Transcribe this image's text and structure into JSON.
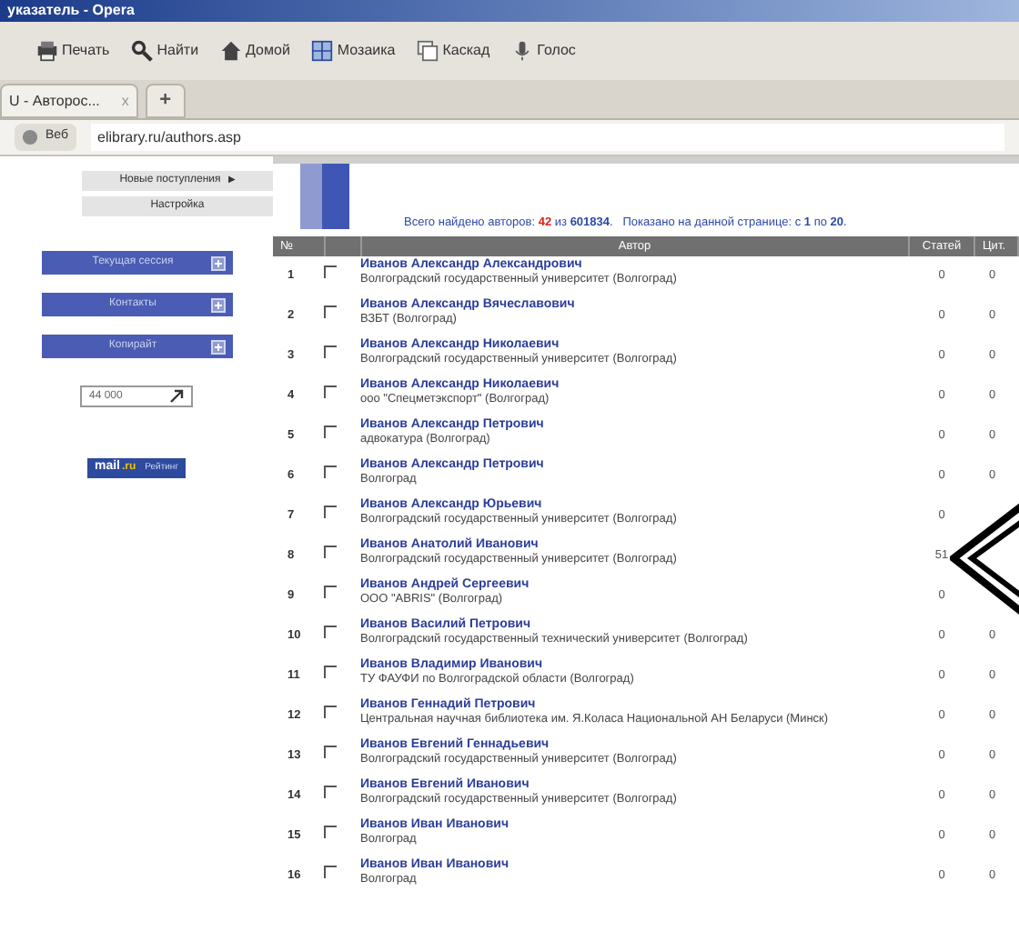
{
  "window": {
    "title": "указатель - Opera"
  },
  "toolbar": [
    "Печать",
    "Найти",
    "Домой",
    "Мозаика",
    "Каскад",
    "Голос"
  ],
  "tab": {
    "label": "U - Авторос...",
    "close": "x",
    "new_tab": "+"
  },
  "address": {
    "badge": "Веб",
    "url": "elibrary.ru/authors.asp"
  },
  "sidebar": {
    "links": [
      {
        "label": "Новые поступления",
        "arrow": "▶"
      },
      {
        "label": "Настройка"
      }
    ],
    "sections": [
      "Текущая сессия",
      "Контакты",
      "Копирайт"
    ],
    "counter": "44 000",
    "rating": {
      "mail": "mail",
      "ru": ".ru",
      "text": "Рейтинг"
    }
  },
  "summary": {
    "prefix": "Всего найдено авторов: ",
    "found": "42",
    "mid": " из ",
    "total": "601834",
    "shown": ".   Показано на данной странице: с ",
    "from": "1",
    "to_word": " по ",
    "to": "20",
    "end": "."
  },
  "table": {
    "columns": [
      "№",
      "Автор",
      "Статей",
      "Цит."
    ],
    "rows": [
      {
        "n": "1",
        "name": "Иванов Александр Александрович",
        "org": "Волгоградский государственный университет (Волгоград)",
        "papers": "0",
        "cites": "0",
        "checked": false
      },
      {
        "n": "2",
        "name": "Иванов Александр Вячеславович",
        "org": "ВЗБТ (Волгоград)",
        "papers": "0",
        "cites": "0",
        "checked": false
      },
      {
        "n": "3",
        "name": "Иванов Александр Николаевич",
        "org": "Волгоградский государственный университет (Волгоград)",
        "papers": "0",
        "cites": "0",
        "checked": false
      },
      {
        "n": "4",
        "name": "Иванов Александр Николаевич",
        "org": "ооо \"Спецметэкспорт\" (Волгоград)",
        "papers": "0",
        "cites": "0",
        "checked": false
      },
      {
        "n": "5",
        "name": "Иванов Александр Петрович",
        "org": "адвокатура (Волгоград)",
        "papers": "0",
        "cites": "0",
        "checked": false
      },
      {
        "n": "6",
        "name": "Иванов Александр Петрович",
        "org": "Волгоград",
        "papers": "0",
        "cites": "0",
        "checked": false
      },
      {
        "n": "7",
        "name": "Иванов Александр Юрьевич",
        "org": "Волгоградский государственный университет (Волгоград)",
        "papers": "0",
        "checked": false
      },
      {
        "n": "8",
        "name": "Иванов Анатолий Иванович",
        "org": "Волгоградский государственный университет (Волгоград)",
        "papers": "51",
        "checked": false
      },
      {
        "n": "9",
        "name": "Иванов Андрей Сергеевич",
        "org": "ООО \"ABRIS\" (Волгоград)",
        "papers": "0",
        "checked": false
      },
      {
        "n": "10",
        "name": "Иванов Василий Петрович",
        "org": "Волгоградский государственный технический университет (Волгоград)",
        "papers": "0",
        "cites": "0",
        "checked": false
      },
      {
        "n": "11",
        "name": "Иванов Владимир Иванович",
        "org": "ТУ ФАУФИ по Волгоградской области (Волгоград)",
        "papers": "0",
        "cites": "0",
        "checked": false
      },
      {
        "n": "12",
        "name": "Иванов Геннадий Петрович",
        "org": "Центральная научная библиотека им. Я.Коласа Национальной АН Беларуси (Минск)",
        "papers": "0",
        "cites": "0",
        "checked": false
      },
      {
        "n": "13",
        "name": "Иванов Евгений Геннадьевич",
        "org": "Волгоградский государственный университет (Волгоград)",
        "papers": "0",
        "cites": "0",
        "checked": false
      },
      {
        "n": "14",
        "name": "Иванов Евгений Иванович",
        "org": "Волгоградский государственный университет (Волгоград)",
        "papers": "0",
        "cites": "0",
        "checked": false
      },
      {
        "n": "15",
        "name": "Иванов Иван Иванович",
        "org": "Волгоград",
        "papers": "0",
        "cites": "0",
        "checked": false
      },
      {
        "n": "16",
        "name": "Иванов Иван Иванович",
        "org": "Волгоград",
        "papers": "0",
        "cites": "0",
        "checked": false
      }
    ]
  }
}
